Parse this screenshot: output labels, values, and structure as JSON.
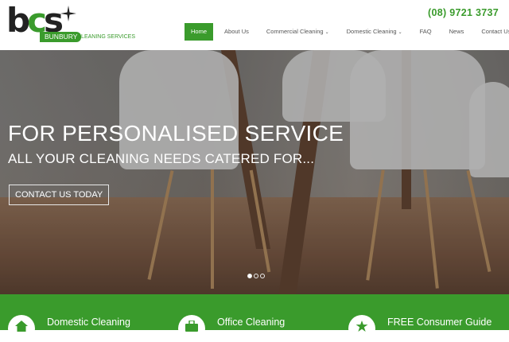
{
  "logo": {
    "letters_b": "b",
    "letters_c": "c",
    "letters_s": "s",
    "badge": "BUNBURY",
    "tagline": "CLEANING SERVICES"
  },
  "phone": "(08) 9721 3737",
  "nav": [
    {
      "label": "Home",
      "active": true,
      "dropdown": false
    },
    {
      "label": "About Us",
      "active": false,
      "dropdown": false
    },
    {
      "label": "Commercial Cleaning",
      "active": false,
      "dropdown": true
    },
    {
      "label": "Domestic Cleaning",
      "active": false,
      "dropdown": true
    },
    {
      "label": "FAQ",
      "active": false,
      "dropdown": false
    },
    {
      "label": "News",
      "active": false,
      "dropdown": false
    },
    {
      "label": "Contact Us",
      "active": false,
      "dropdown": false
    }
  ],
  "hero": {
    "heading": "FOR PERSONALISED SERVICE",
    "subheading": "ALL YOUR CLEANING NEEDS CATERED FOR...",
    "cta": "CONTACT US TODAY",
    "slides": 3,
    "active_slide": 1
  },
  "features": [
    {
      "label": "Domestic Cleaning",
      "icon": "home-icon"
    },
    {
      "label": "Office Cleaning",
      "icon": "briefcase-icon"
    },
    {
      "label": "FREE Consumer Guide",
      "icon": "star-icon"
    }
  ],
  "colors": {
    "brand_green": "#3a9b2c"
  }
}
